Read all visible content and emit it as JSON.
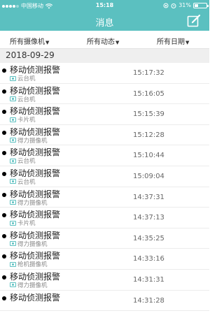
{
  "status_bar": {
    "carrier": "中国移动",
    "time": "15:18",
    "battery": "31%",
    "battery_level": 0.31
  },
  "nav": {
    "title": "消息",
    "compose_icon": "edit-icon"
  },
  "filters": [
    {
      "label": "所有摄像机",
      "icon": "caret-down-icon"
    },
    {
      "label": "所有动态",
      "icon": "caret-down-icon"
    },
    {
      "label": "所有日期",
      "icon": "caret-down-icon"
    }
  ],
  "date_header": "2018-09-29",
  "messages": [
    {
      "title": "移动侦测报警",
      "camera": "云台机",
      "time": "15:17:32"
    },
    {
      "title": "移动侦测报警",
      "camera": "云台机",
      "time": "15:16:05"
    },
    {
      "title": "移动侦测报警",
      "camera": "卡片机",
      "time": "15:15:39"
    },
    {
      "title": "移动侦测报警",
      "camera": "得力摄像机",
      "time": "15:12:28"
    },
    {
      "title": "移动侦测报警",
      "camera": "云台机",
      "time": "15:10:44"
    },
    {
      "title": "移动侦测报警",
      "camera": "云台机",
      "time": "15:09:04"
    },
    {
      "title": "移动侦测报警",
      "camera": "得力摄像机",
      "time": "14:37:31"
    },
    {
      "title": "移动侦测报警",
      "camera": "卡片机",
      "time": "14:37:13"
    },
    {
      "title": "移动侦测报警",
      "camera": "得力摄像机",
      "time": "14:35:25"
    },
    {
      "title": "移动侦测报警",
      "camera": "枪机摄像机",
      "time": "14:33:16"
    },
    {
      "title": "移动侦测报警",
      "camera": "得力摄像机",
      "time": "14:31:31"
    },
    {
      "title": "移动侦测报警",
      "camera": "",
      "time": "14:31:28"
    }
  ],
  "colors": {
    "accent": "#5bc0c0",
    "date_bar": "#efefef",
    "unread_dot": "#000000"
  }
}
